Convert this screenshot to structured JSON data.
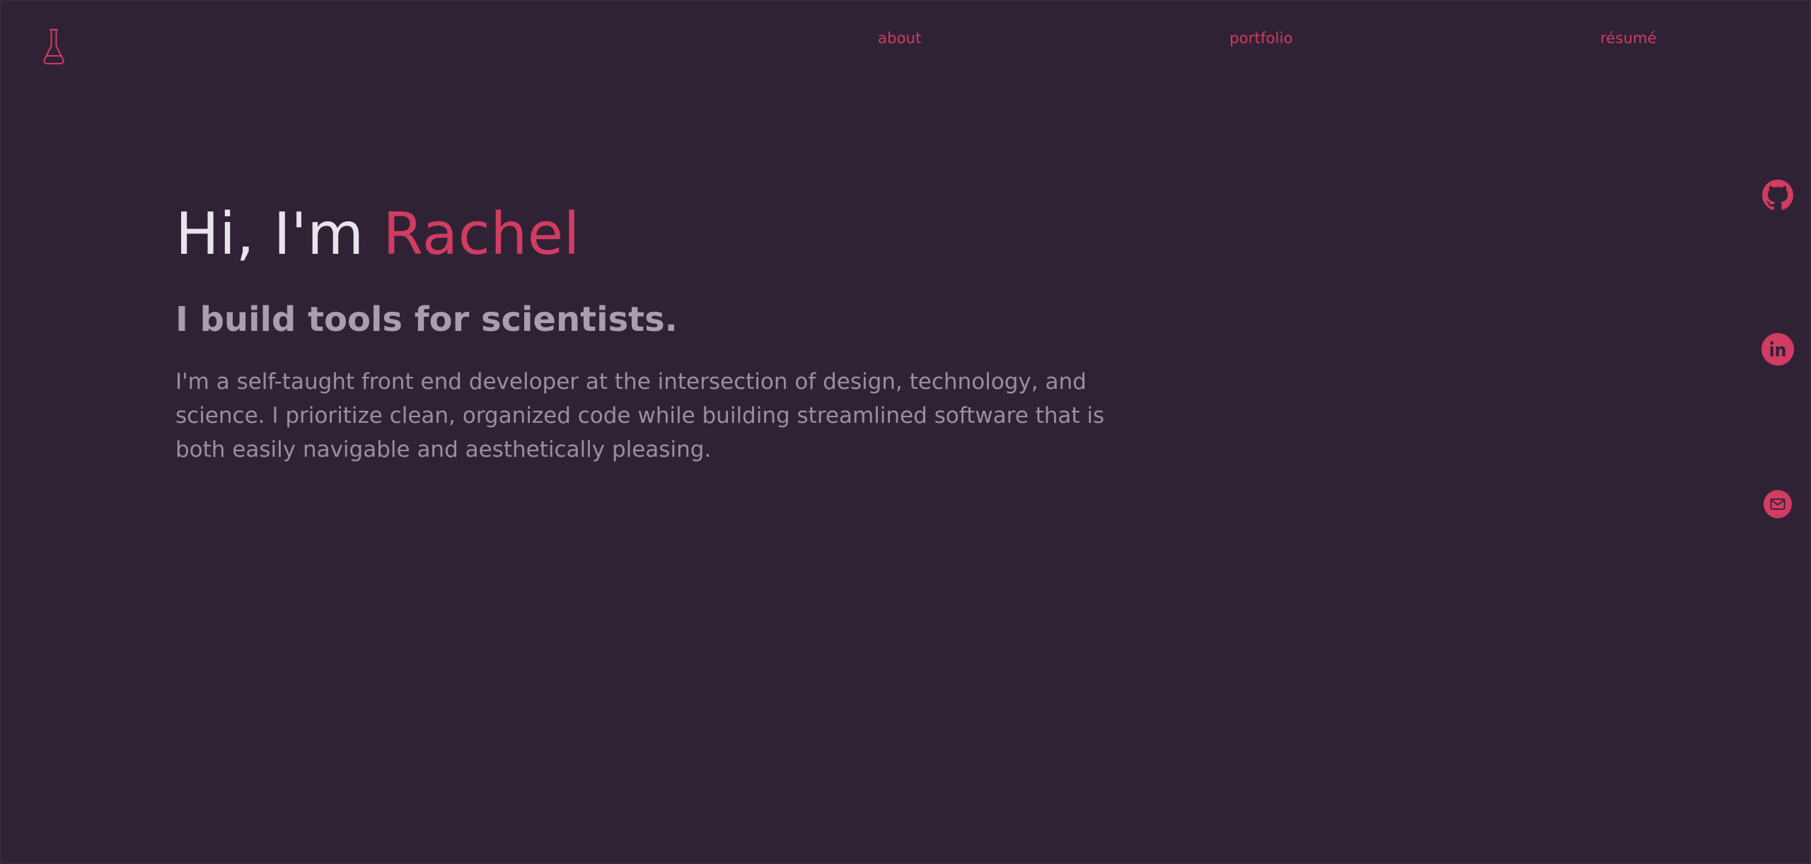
{
  "nav": {
    "items": [
      {
        "label": "about"
      },
      {
        "label": "portfolio"
      },
      {
        "label": "résumé"
      }
    ]
  },
  "hero": {
    "greeting": "Hi, I'm ",
    "name": "Rachel",
    "subtitle": "I build tools for scientists.",
    "body": "I'm a self-taught front end developer at the intersection of design, technology, and science. I prioritize clean, organized code while building streamlined software that is both easily navigable and aesthetically pleasing."
  },
  "social": {
    "items": [
      {
        "icon": "github-icon"
      },
      {
        "icon": "linkedin-icon"
      },
      {
        "icon": "mail-icon"
      }
    ]
  },
  "colors": {
    "background": "#302235",
    "accent": "#d13c63",
    "title": "#e9e3ec",
    "subtitle": "#aa9eae",
    "body": "#9a8f9f"
  }
}
